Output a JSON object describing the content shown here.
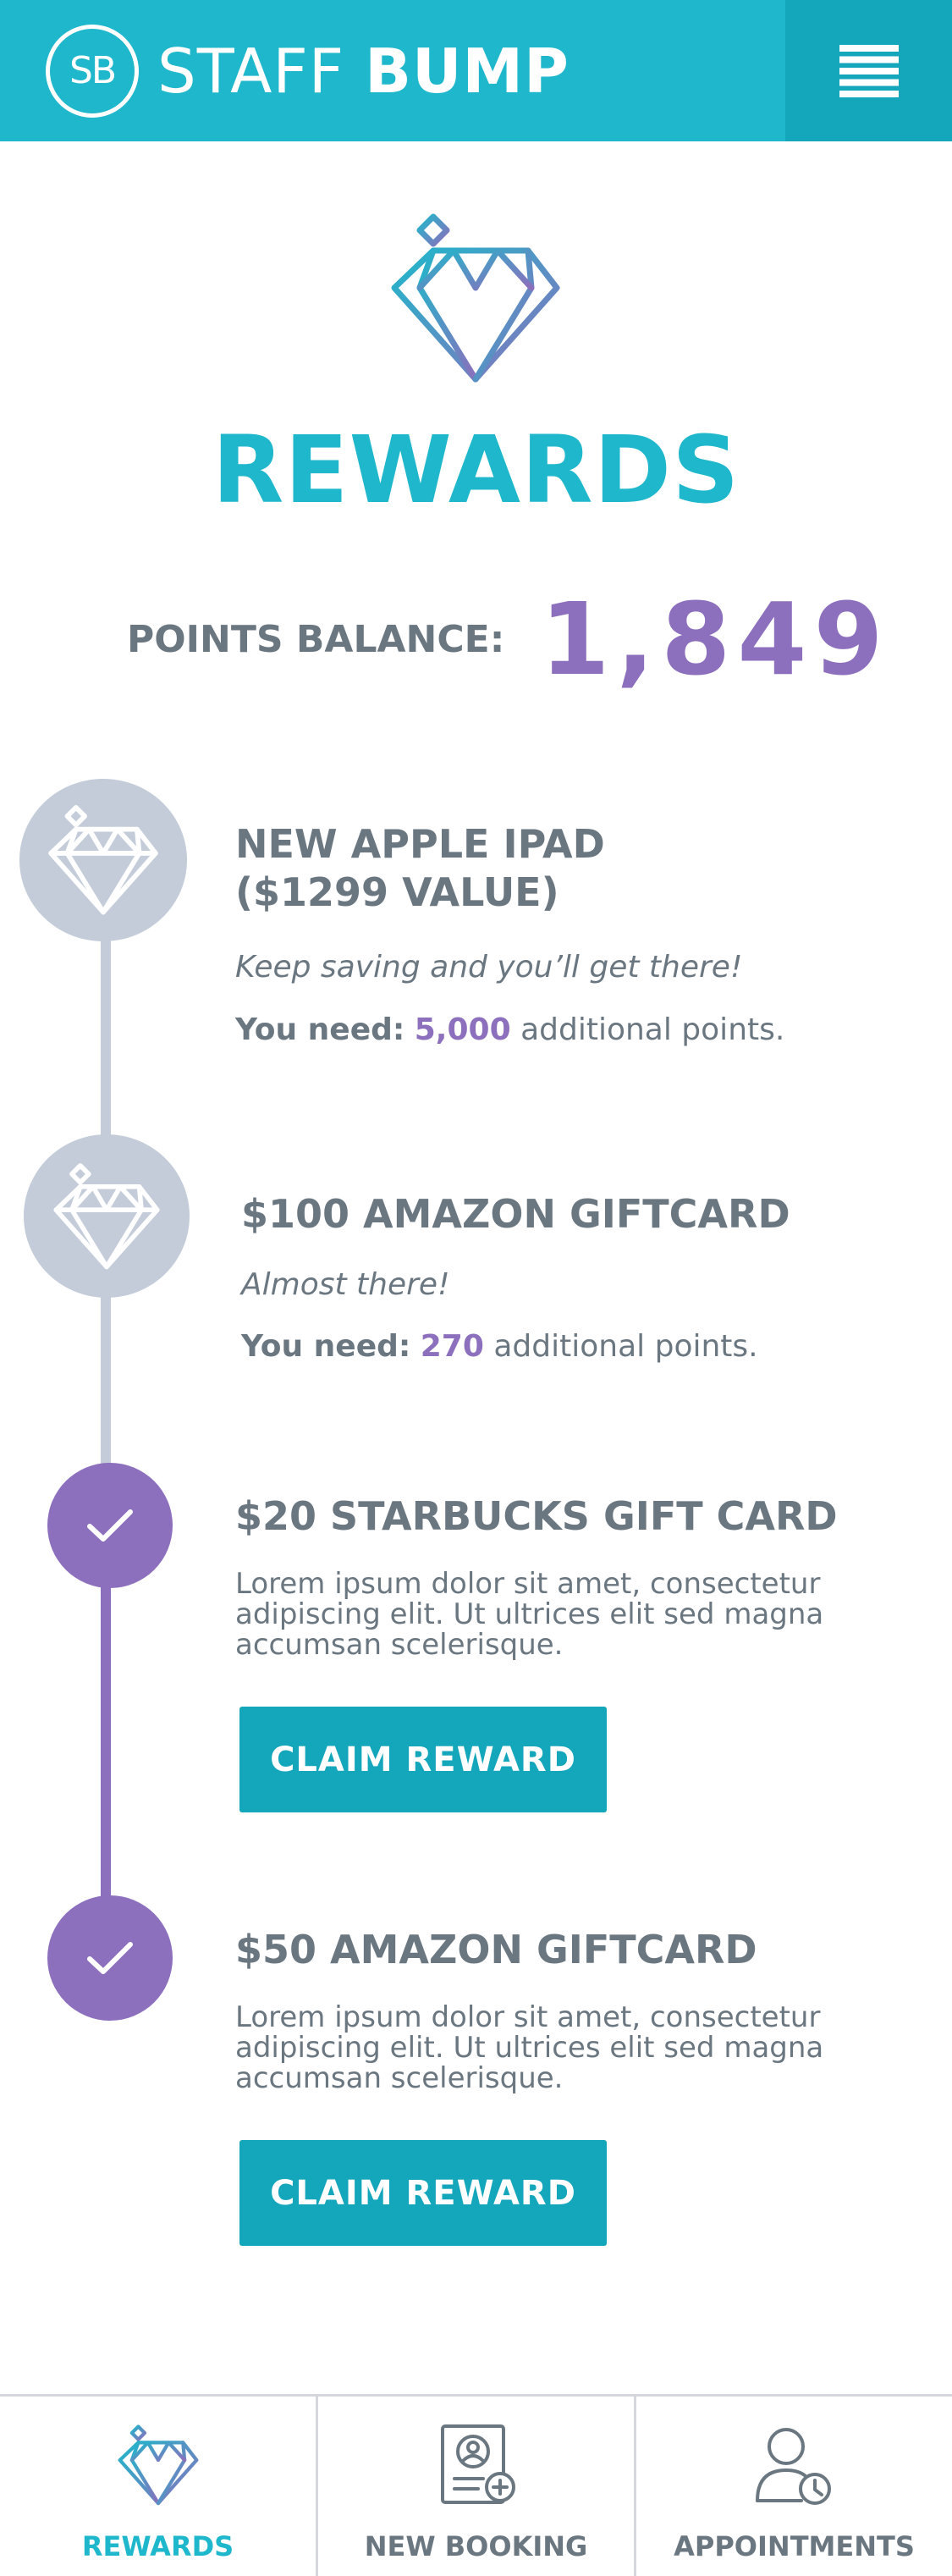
{
  "header": {
    "logo_text": "SB",
    "brand_thin": "STAFF",
    "brand_bold": "BUMP",
    "menu_icon": "hamburger-menu-icon"
  },
  "hero": {
    "icon": "diamond-icon",
    "title": "REWARDS",
    "points_label": "POINTS BALANCE:",
    "points_value": "1,849"
  },
  "rewards": [
    {
      "status": "locked",
      "icon": "diamond-icon",
      "title_line1": "NEW  APPLE IPAD",
      "title_line2": "($1299 VALUE)",
      "note": "Keep saving and you’ll get there!",
      "need_label": "You need:",
      "need_value": "5,000",
      "need_suffix": "additional points."
    },
    {
      "status": "locked",
      "icon": "diamond-icon",
      "title": "$100 AMAZON GIFTCARD",
      "note": "Almost there!",
      "need_label": "You need:",
      "need_value": "270",
      "need_suffix": "additional points."
    },
    {
      "status": "unlocked",
      "icon": "checkmark-icon",
      "title": "$20 STARBUCKS GIFT CARD",
      "description": "Lorem ipsum dolor sit amet, consectetur adipiscing elit. Ut ultrices elit sed magna accumsan scelerisque.",
      "button_label": "CLAIM REWARD"
    },
    {
      "status": "unlocked",
      "icon": "checkmark-icon",
      "title": "$50 AMAZON GIFTCARD",
      "description": "Lorem ipsum dolor sit amet, consectetur adipiscing elit. Ut ultrices elit sed magna accumsan scelerisque.",
      "button_label": "CLAIM REWARD"
    }
  ],
  "bottom_nav": [
    {
      "label": "REWARDS",
      "icon": "diamond-icon",
      "active": true
    },
    {
      "label": "NEW BOOKING",
      "icon": "add-booking-icon",
      "active": false
    },
    {
      "label": "APPOINTMENTS",
      "icon": "user-clock-icon",
      "active": false
    }
  ],
  "colors": {
    "brand_teal": "#1fb7cb",
    "button_teal": "#14a6bb",
    "accent_purple": "#8c6fbd",
    "locked_gray": "#c3ccd8",
    "text_gray": "#6b7780"
  }
}
